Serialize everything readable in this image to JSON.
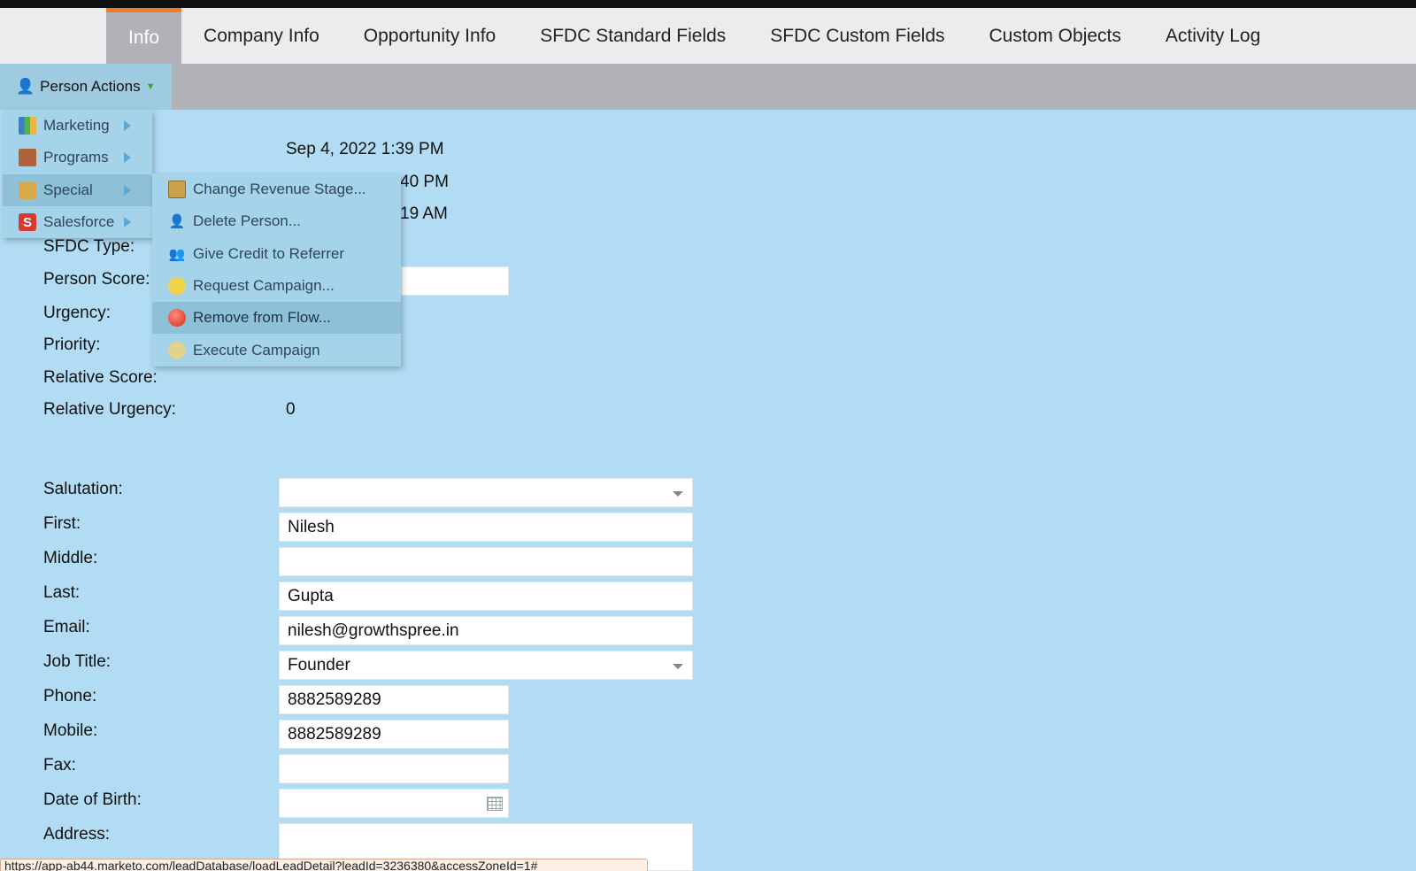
{
  "tabs": [
    {
      "label": "Info",
      "active": true
    },
    {
      "label": "Company Info"
    },
    {
      "label": "Opportunity Info"
    },
    {
      "label": "SFDC Standard Fields"
    },
    {
      "label": "SFDC Custom Fields"
    },
    {
      "label": "Custom Objects"
    },
    {
      "label": "Activity Log"
    }
  ],
  "person_actions": {
    "label": "Person Actions"
  },
  "menu": {
    "items": [
      {
        "label": "Marketing",
        "icon": "marketing-icon"
      },
      {
        "label": "Programs",
        "icon": "programs-icon"
      },
      {
        "label": "Special",
        "icon": "special-icon"
      },
      {
        "label": "Salesforce",
        "icon": "salesforce-icon"
      }
    ],
    "special_submenu": [
      {
        "label": "Change Revenue Stage...",
        "icon": "revenue-stage-icon"
      },
      {
        "label": "Delete Person...",
        "icon": "delete-person-icon"
      },
      {
        "label": "Give Credit to Referrer",
        "icon": "referrer-credit-icon"
      },
      {
        "label": "Request Campaign...",
        "icon": "request-campaign-icon"
      },
      {
        "label": "Remove from Flow...",
        "icon": "remove-flow-icon"
      },
      {
        "label": "Execute Campaign",
        "icon": "execute-campaign-icon"
      }
    ]
  },
  "info": {
    "created_date": "Sep 4, 2022 1:39 PM",
    "partial_date_1": "40 PM",
    "partial_date_2": "19 AM",
    "sfdc_type_label": "SFDC Type:",
    "person_score_label": "Person Score:",
    "urgency_label": "Urgency:",
    "priority_label": "Priority:",
    "relative_score_label": "Relative Score:",
    "relative_urgency_label": "Relative Urgency:",
    "relative_urgency_value": "0"
  },
  "form": {
    "salutation_label": "Salutation:",
    "salutation_value": "",
    "first_label": "First:",
    "first_value": "Nilesh",
    "middle_label": "Middle:",
    "middle_value": "",
    "last_label": "Last:",
    "last_value": "Gupta",
    "email_label": "Email:",
    "email_value": "nilesh@growthspree.in",
    "job_title_label": "Job Title:",
    "job_title_value": "Founder",
    "phone_label": "Phone:",
    "phone_value": "8882589289",
    "mobile_label": "Mobile:",
    "mobile_value": "8882589289",
    "fax_label": "Fax:",
    "fax_value": "",
    "dob_label": "Date of Birth:",
    "dob_value": "",
    "address_label": "Address:",
    "address_value": ""
  },
  "status_url": "https://app-ab44.marketo.com/leadDatabase/loadLeadDetail?leadId=3236380&accessZoneId=1#"
}
